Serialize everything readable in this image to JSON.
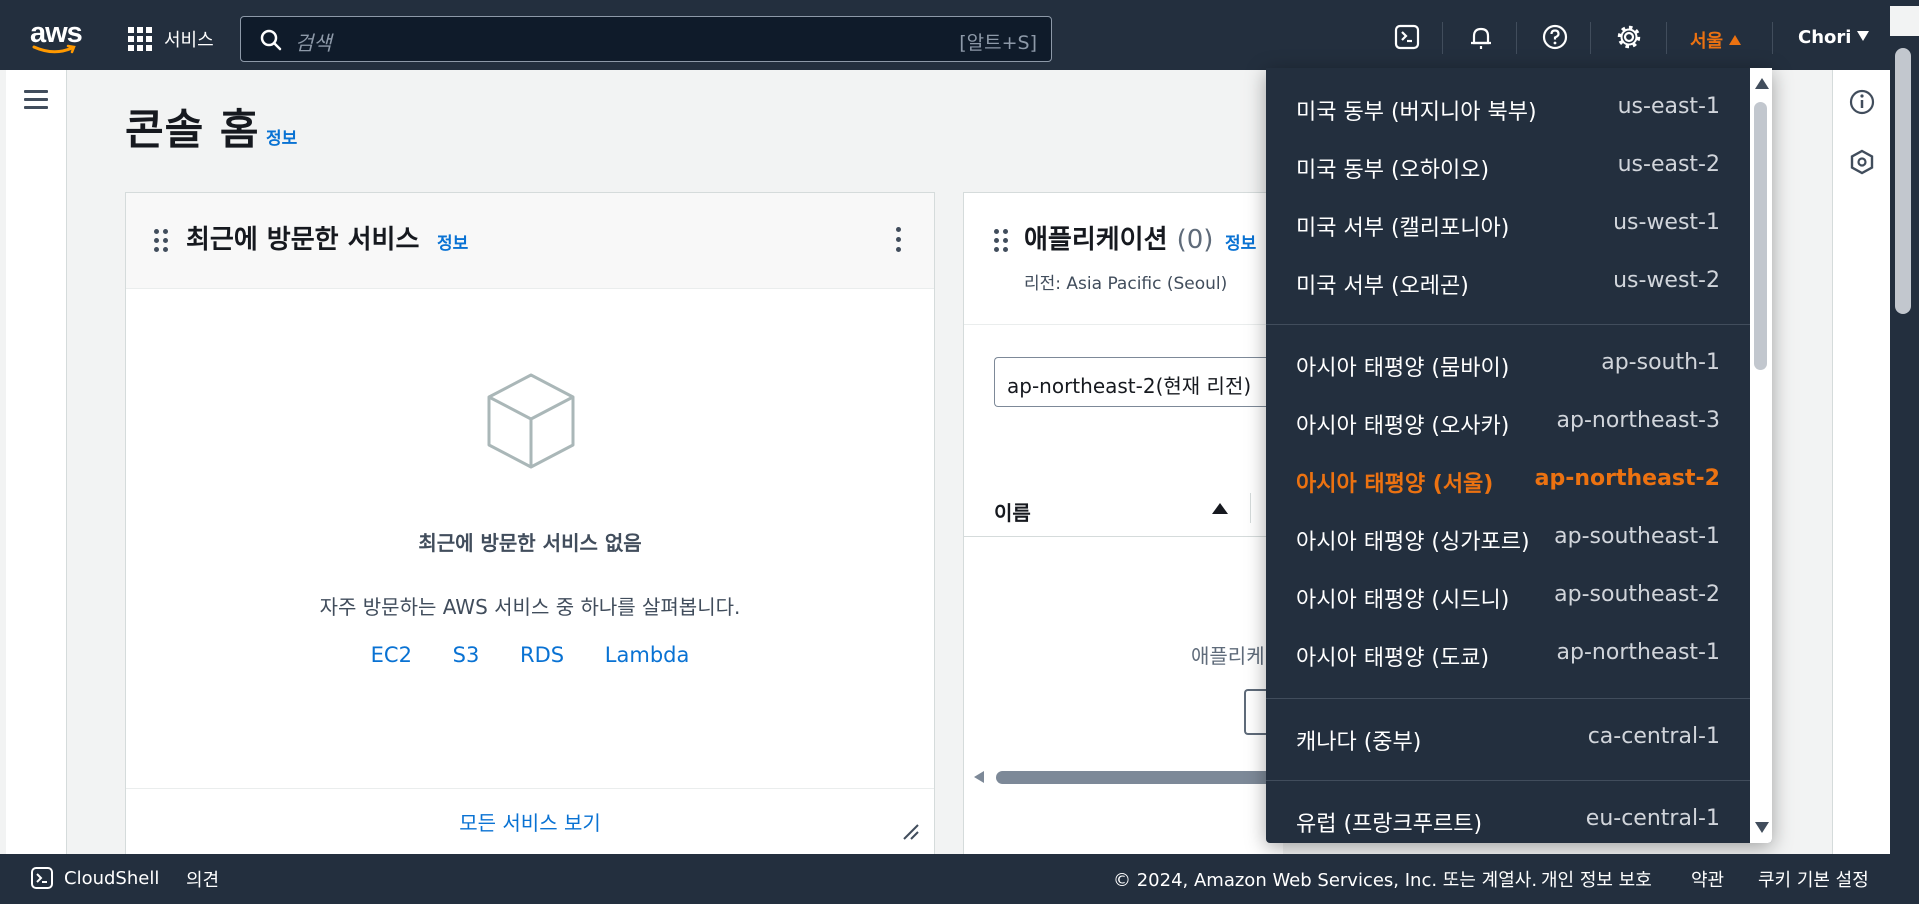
{
  "nav": {
    "logo_text": "aws",
    "services_label": "서비스",
    "search_placeholder": "검색",
    "search_shortcut": "[알트+S]",
    "region_label": "서울",
    "user_label": "Chori",
    "icons": [
      "cloudshell-icon",
      "bell-icon",
      "help-icon",
      "gear-icon"
    ]
  },
  "page": {
    "title": "콘솔 홈",
    "title_info": "정보"
  },
  "recent_services": {
    "title": "최근에 방문한 서비스",
    "info": "정보",
    "empty_title": "최근에 방문한 서비스 없음",
    "empty_subtitle": "자주 방문하는 AWS 서비스 중 하나를 살펴봅니다.",
    "links": [
      "EC2",
      "S3",
      "RDS",
      "Lambda"
    ],
    "view_all": "모든 서비스 보기"
  },
  "applications": {
    "title": "애플리케이션",
    "count": "(0)",
    "info": "정보",
    "region_text": "리전: Asia Pacific (Seoul)",
    "region_select": "ap-northeast-2(현재 리전)",
    "col_name": "이름",
    "empty_text": "애플리케이"
  },
  "region_menu": {
    "groups": [
      [
        {
          "name": "미국 동부 (버지니아 북부)",
          "code": "us-east-1"
        },
        {
          "name": "미국 동부 (오하이오)",
          "code": "us-east-2"
        },
        {
          "name": "미국 서부 (캘리포니아)",
          "code": "us-west-1"
        },
        {
          "name": "미국 서부 (오레곤)",
          "code": "us-west-2"
        }
      ],
      [
        {
          "name": "아시아 태평양 (뭄바이)",
          "code": "ap-south-1"
        },
        {
          "name": "아시아 태평양 (오사카)",
          "code": "ap-northeast-3"
        },
        {
          "name": "아시아 태평양 (서울)",
          "code": "ap-northeast-2",
          "selected": true
        },
        {
          "name": "아시아 태평양 (싱가포르)",
          "code": "ap-southeast-1"
        },
        {
          "name": "아시아 태평양 (시드니)",
          "code": "ap-southeast-2"
        },
        {
          "name": "아시아 태평양 (도쿄)",
          "code": "ap-northeast-1"
        }
      ],
      [
        {
          "name": "캐나다 (중부)",
          "code": "ca-central-1"
        }
      ],
      [
        {
          "name": "유럽 (프랑크푸르트)",
          "code": "eu-central-1"
        }
      ]
    ],
    "selected_color": "#ec7211"
  },
  "footer": {
    "cloudshell": "CloudShell",
    "feedback": "의견",
    "copyright": "© 2024, Amazon Web Services, Inc. 또는 계열사.",
    "privacy": "개인 정보 보호",
    "terms": "약관",
    "cookies": "쿠키 기본 설정"
  },
  "colors": {
    "nav_bg": "#232f3e",
    "link": "#0972d3",
    "accent": "#ec7211"
  }
}
